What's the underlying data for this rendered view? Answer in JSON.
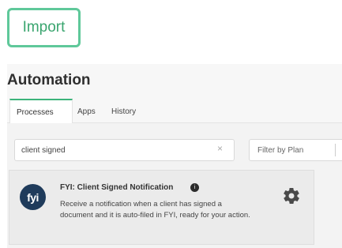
{
  "import_button": {
    "label": "Import"
  },
  "automation": {
    "title": "Automation",
    "tabs": [
      {
        "label": "Processes",
        "active": true
      },
      {
        "label": "Apps",
        "active": false
      },
      {
        "label": "History",
        "active": false
      }
    ],
    "search": {
      "value": "client signed",
      "clear_icon": "close-icon"
    },
    "plan_filter": {
      "placeholder": "Filter by Plan",
      "icon": "chevron-down-icon"
    },
    "result_card": {
      "avatar_text": "fyi",
      "title": "FYI: Client Signed Notification",
      "info_icon": "info-icon",
      "description": "Receive a notification when a client has signed a document and it is auto-filed in FYI, ready for your action.",
      "settings_icon": "gear-icon"
    }
  },
  "colors": {
    "accent": "#3bb37a",
    "import_border": "#5fc89a",
    "avatar_bg": "#1f3b5b"
  }
}
